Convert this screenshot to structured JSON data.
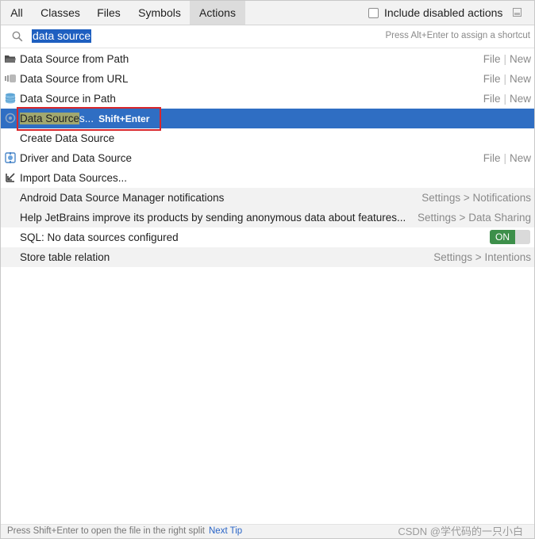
{
  "tabs": [
    "All",
    "Classes",
    "Files",
    "Symbols",
    "Actions"
  ],
  "include_disabled_label": "Include disabled actions",
  "search": {
    "value": "data source",
    "hint": "Press Alt+Enter to assign a shortcut"
  },
  "rows": [
    {
      "label": "Data Source from Path",
      "right_a": "File",
      "right_b": "New",
      "icon": "folder-icon"
    },
    {
      "label": "Data Source from URL",
      "right_a": "File",
      "right_b": "New",
      "icon": "url-icon"
    },
    {
      "label": "Data Source in Path",
      "right_a": "File",
      "right_b": "New",
      "icon": "database-icon"
    },
    {
      "label_hl": "Data Source",
      "label_rest": "s...",
      "shortcut": "Shift+Enter",
      "icon": "datasources-icon"
    },
    {
      "label": "Create Data Source"
    },
    {
      "label": "Driver and Data Source",
      "right_a": "File",
      "right_b": "New",
      "icon": "driver-icon"
    },
    {
      "label": "Import Data Sources...",
      "icon": "import-icon"
    },
    {
      "label": "Android Data Source Manager notifications",
      "right": "Settings > Notifications"
    },
    {
      "label": "Help JetBrains improve its products by sending anonymous data about features...",
      "right": "Settings > Data Sharing"
    },
    {
      "label": "SQL: No data sources configured",
      "toggle": "ON"
    },
    {
      "label": "Store table relation",
      "right": "Settings > Intentions"
    }
  ],
  "status": {
    "tip": "Press Shift+Enter to open the file in the right split",
    "next_tip": "Next Tip"
  },
  "watermark": "CSDN @学代码的一只小白",
  "colors": {
    "selection": "#2f6ec3",
    "highlight": "#a2a86f",
    "toggle_on": "#3d8f4a",
    "link": "#2a65c7",
    "annotation": "#d9262b"
  }
}
